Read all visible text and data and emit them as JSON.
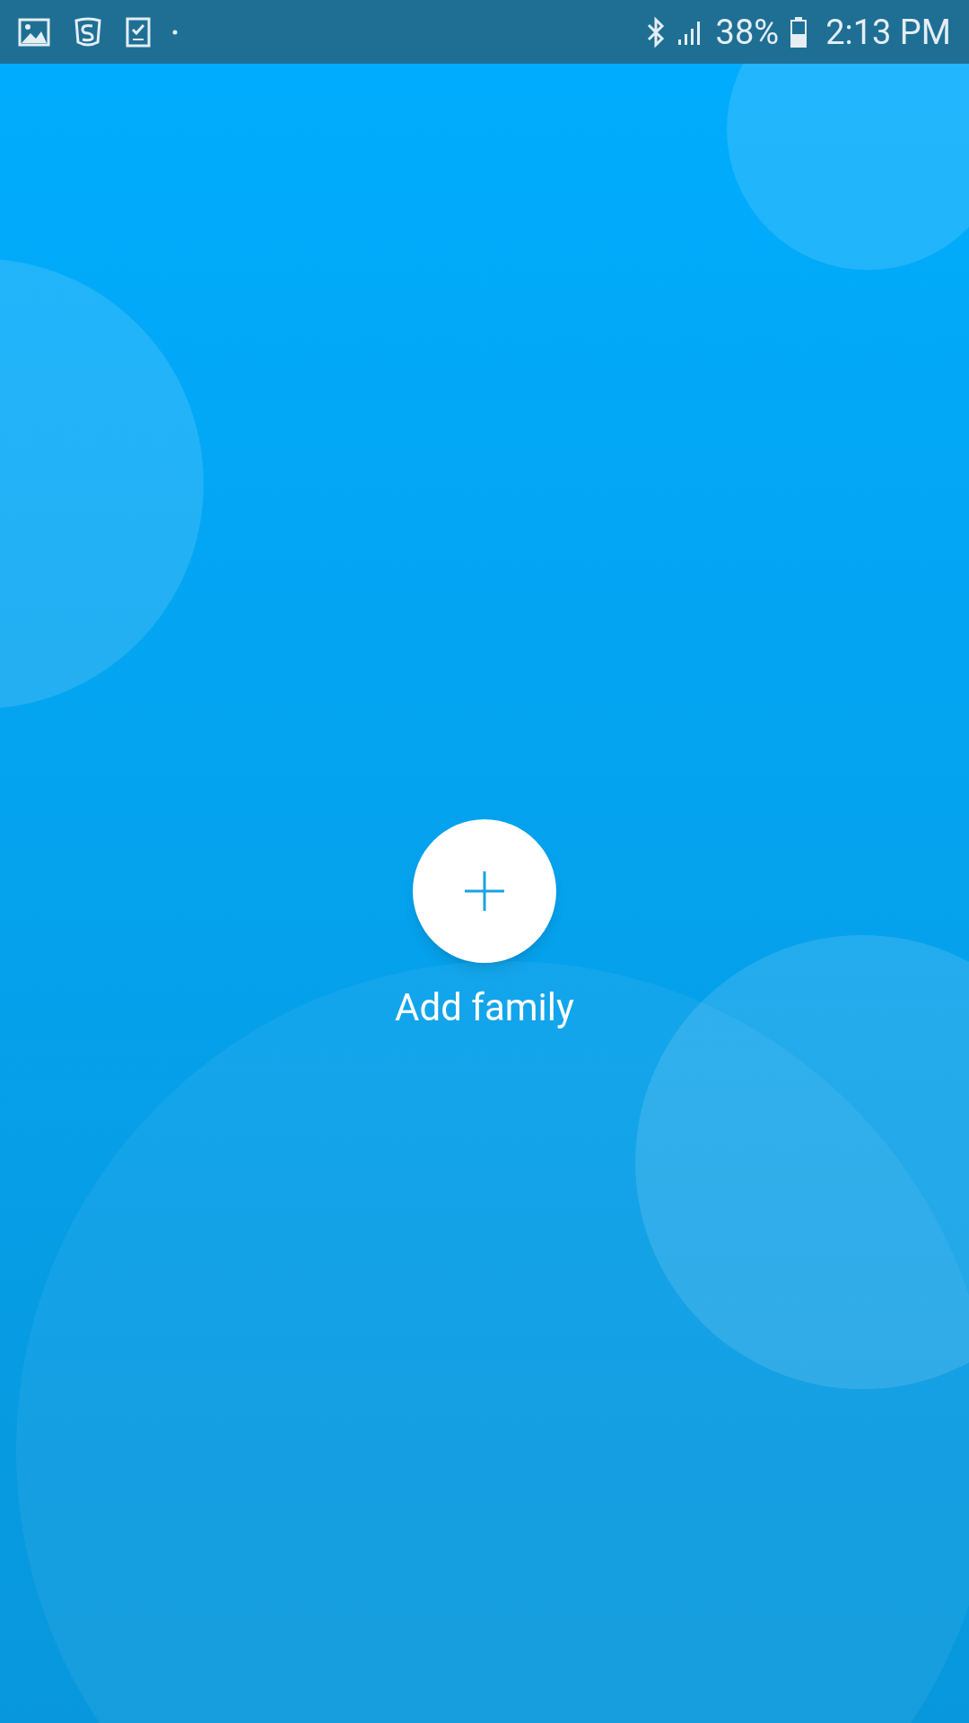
{
  "status_bar": {
    "battery_percent": "38%",
    "time": "2:13 PM"
  },
  "add_button": {
    "label": "Add family"
  }
}
